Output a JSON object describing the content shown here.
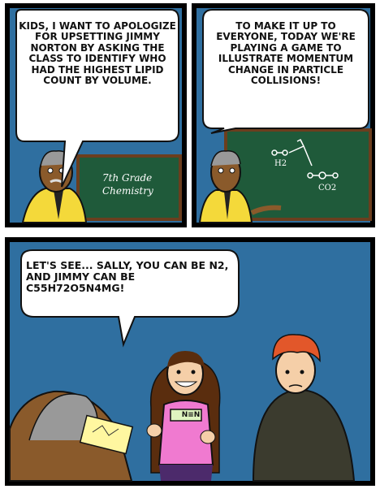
{
  "comic": {
    "panel1": {
      "speech": "KIDS, I WANT TO APOLOGIZE FOR UPSETTING JIMMY NORTON BY ASKING THE CLASS TO IDENTIFY WHO HAD THE HIGHEST LIPID COUNT BY VOLUME.",
      "board_line1": "7th Grade",
      "board_line2": "Chemistry"
    },
    "panel2": {
      "speech": "TO MAKE IT UP TO EVERYONE, TODAY WE'RE PLAYING A GAME TO ILLUSTRATE MOMENTUM CHANGE IN PARTICLE COLLISIONS!",
      "label_h2": "H2",
      "label_co2": "CO2"
    },
    "panel3": {
      "speech": "LET'S SEE... SALLY, YOU CAN BE N2, AND JIMMY CAN BE C55H72O5N4Mg!",
      "badge": "N≡N"
    }
  },
  "colors": {
    "background_wall": "#2f6fa0",
    "chalkboard": "#1f5a3a",
    "skin_teacher": "#8a5a2b",
    "shirt_teacher": "#f4d93a",
    "shirt_sally": "#f07ad0",
    "shirt_jimmy": "#3b3b2e",
    "hair_jimmy": "#e2572a"
  }
}
